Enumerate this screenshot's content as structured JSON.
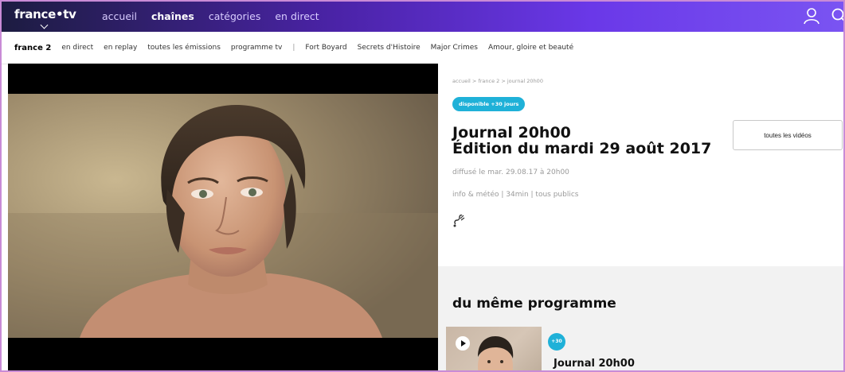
{
  "header": {
    "logo": "france•tv",
    "nav": [
      {
        "label": "accueil"
      },
      {
        "label": "chaînes"
      },
      {
        "label": "catégories"
      },
      {
        "label": "en direct"
      }
    ]
  },
  "subnav": {
    "channel": "france 2",
    "items": [
      {
        "label": "en direct"
      },
      {
        "label": "en replay"
      },
      {
        "label": "toutes les émissions"
      },
      {
        "label": "programme tv"
      }
    ],
    "separator": "|",
    "shows": [
      {
        "label": "Fort Boyard"
      },
      {
        "label": "Secrets d'Histoire"
      },
      {
        "label": "Major Crimes"
      },
      {
        "label": "Amour, gloire et beauté"
      }
    ]
  },
  "program": {
    "breadcrumb": "accueil > france 2 > journal 20h00",
    "badge": "disponible +30 jours",
    "title_line1": "Journal 20h00",
    "title_line2": "Édition du mardi 29 août 2017",
    "broadcast": "diffusé le mar. 29.08.17 à 20h00",
    "info": "info & météo | 34min | tous publics",
    "all_videos_button": "toutes les vidéos"
  },
  "same_program": {
    "heading": "du même programme",
    "items": [
      {
        "badge": "+30",
        "title": "Journal 20h00"
      }
    ]
  },
  "colors": {
    "header_gradient_start": "#1c1c40",
    "header_gradient_end": "#7a54f2",
    "badge": "#1fb1d8"
  }
}
